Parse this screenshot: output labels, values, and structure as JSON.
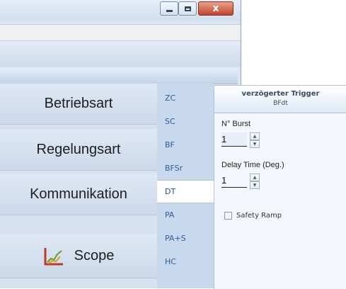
{
  "titlebar": {
    "icons": {
      "minimize": "minimize-icon",
      "maximize": "maximize-icon",
      "close": "close-icon"
    },
    "glyphs": {
      "close": "x"
    }
  },
  "nav": {
    "items": [
      {
        "label": "Betriebsart"
      },
      {
        "label": "Regelungsart"
      },
      {
        "label": "Kommunikation"
      },
      {
        "label": "Scope",
        "icon": "scope-chart-icon"
      }
    ]
  },
  "modes": {
    "tabs": [
      {
        "label": "ZC"
      },
      {
        "label": "SC"
      },
      {
        "label": "BF"
      },
      {
        "label": "BFSr"
      },
      {
        "label": "DT",
        "selected": true
      },
      {
        "label": "PA"
      },
      {
        "label": "PA+S"
      },
      {
        "label": "HC"
      }
    ]
  },
  "detail": {
    "title": "verzögerter Trigger",
    "subtitle": "BFdt",
    "burst_label": "N° Burst",
    "burst_value": "1",
    "delay_label": "Delay Time (Deg.)",
    "delay_value": "1",
    "safety_ramp_label": "Safety Ramp",
    "safety_ramp_checked": false
  },
  "colors": {
    "tab_text": "#2e5c9a",
    "panel_bg": "#d6e2f0",
    "close_button": "#c0452c"
  }
}
